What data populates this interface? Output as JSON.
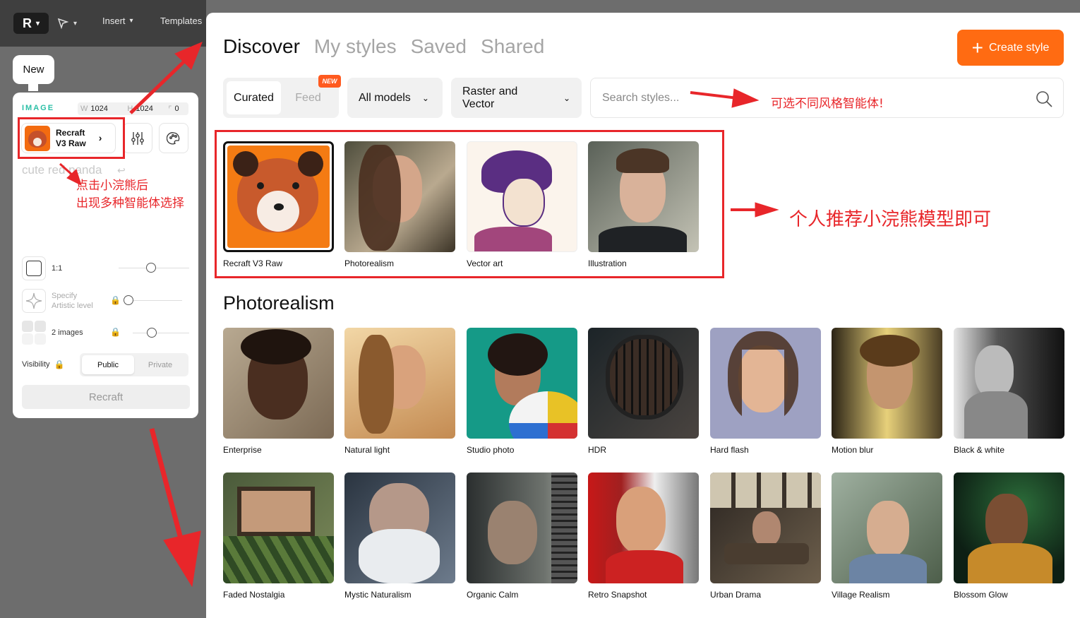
{
  "toolbar": {
    "insert": "Insert",
    "templates": "Templates"
  },
  "panel": {
    "new_tab": "New",
    "image_label": "IMAGE",
    "w_label": "W",
    "w_value": "1024",
    "h_label": "H",
    "h_value": "1024",
    "r_value": "0",
    "model_name_1": "Recraft",
    "model_name_2": "V3 Raw",
    "prompt": "cute red panda",
    "ratio": "1:1",
    "artistic_1": "Specify",
    "artistic_2": "Artistic level",
    "images": "2 images",
    "visibility": "Visibility",
    "public": "Public",
    "private": "Private",
    "recraft": "Recraft"
  },
  "modal": {
    "tabs": [
      "Discover",
      "My styles",
      "Saved",
      "Shared"
    ],
    "create": "Create style",
    "seg_curated": "Curated",
    "seg_feed": "Feed",
    "new_badge": "NEW",
    "dd_models": "All models",
    "dd_type": "Raster and Vector",
    "search_placeholder": "Search styles...",
    "featured": [
      "Recraft V3 Raw",
      "Photorealism",
      "Vector art",
      "Illustration"
    ],
    "section": "Photorealism",
    "row1": [
      "Enterprise",
      "Natural light",
      "Studio photo",
      "HDR",
      "Hard flash",
      "Motion blur",
      "Black & white"
    ],
    "row2": [
      "Faded Nostalgia",
      "Mystic Naturalism",
      "Organic Calm",
      "Retro Snapshot",
      "Urban Drama",
      "Village Realism",
      "Blossom Glow"
    ]
  },
  "annotations": {
    "a1_line1": "点击小浣熊后",
    "a1_line2": "出现多种智能体选择",
    "a2": "可选不同风格智能体!",
    "a3": "个人推荐小浣熊模型即可"
  },
  "colors": {
    "accent": "#ff6b12",
    "annotation": "#e8262a",
    "teal": "#2bbfa6"
  }
}
